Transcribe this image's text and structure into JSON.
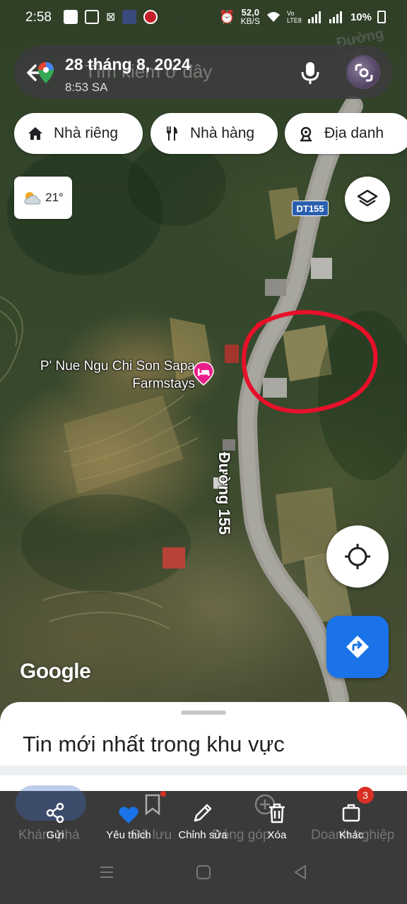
{
  "status_bar": {
    "time": "2:58",
    "net_speed_value": "52,0",
    "net_speed_unit": "KB/S",
    "volte": "Vo LTE8",
    "battery": "10%"
  },
  "search": {
    "placeholder": "Tìm kiếm ở đây",
    "overlay_date": "28 tháng 8, 2024",
    "overlay_time": "8:53 SA"
  },
  "chips": [
    {
      "label": "Nhà riêng",
      "icon": "home-icon"
    },
    {
      "label": "Nhà hàng",
      "icon": "restaurant-icon"
    },
    {
      "label": "Địa danh",
      "icon": "landmark-icon"
    }
  ],
  "weather": {
    "temperature": "21°",
    "icon": "partly-cloudy-icon"
  },
  "map": {
    "road_shield": "DT155",
    "road_name": "Đường 155",
    "poi_name": "P' Nue Ngu Chi Son Sapa Farmstays",
    "attribution": "Google"
  },
  "sheet": {
    "title": "Tin mới nhất trong khu vực"
  },
  "bottom_nav_background": [
    "Khám phá",
    "Đã lưu",
    "Đóng góp",
    "Doanh nghiệp"
  ],
  "bottom_nav": [
    {
      "label": "Gửi",
      "icon": "share-icon"
    },
    {
      "label": "Yêu thích",
      "icon": "heart-icon"
    },
    {
      "label": "Chỉnh sửa",
      "icon": "pencil-icon"
    },
    {
      "label": "Xóa",
      "icon": "trash-icon"
    },
    {
      "label": "Khác",
      "icon": "more-icon"
    }
  ],
  "notification_count": "3",
  "colors": {
    "accent_blue": "#1a73e8",
    "highlight_red": "#e8102a",
    "poi_pink": "#e91e8c",
    "road_shield_blue": "#2a5fb0"
  }
}
